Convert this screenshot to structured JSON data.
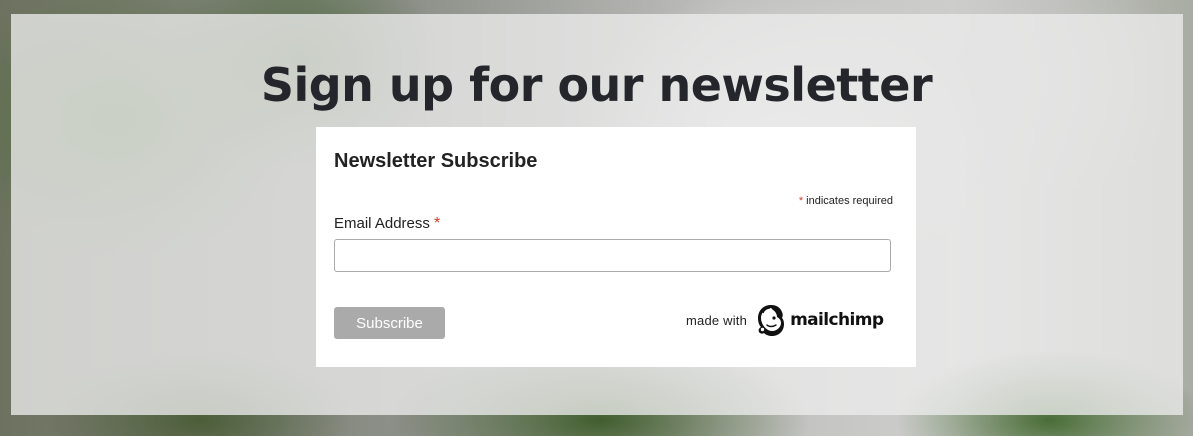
{
  "page": {
    "headline": "Sign up for our newsletter"
  },
  "form": {
    "title": "Newsletter Subscribe",
    "required_asterisk": "*",
    "required_note": "indicates required",
    "email_label": "Email Address",
    "email_asterisk": "*",
    "email_value": "",
    "email_placeholder": "",
    "subscribe_label": "Subscribe"
  },
  "badge": {
    "made_with": "made with",
    "brand": "mailchimp",
    "icon": "mailchimp-freddie-icon"
  },
  "colors": {
    "required": "#d9352b",
    "button_bg": "#aaaaaa",
    "button_text": "#ffffff",
    "headline": "#24262b"
  }
}
